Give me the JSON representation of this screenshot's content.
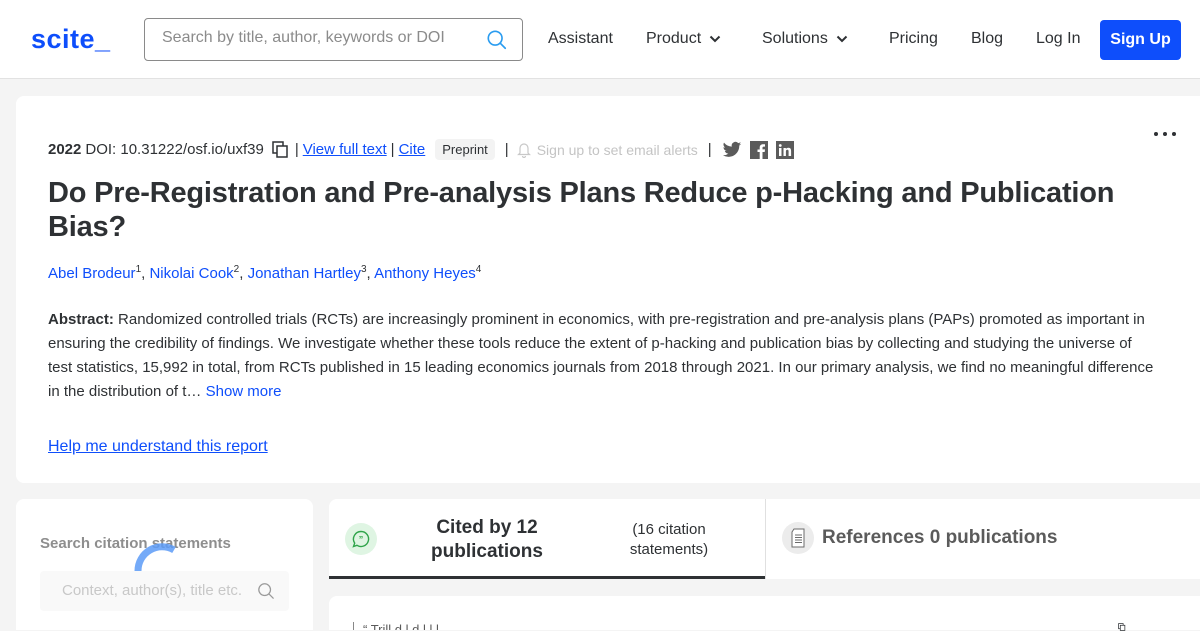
{
  "header": {
    "logo": "scite_",
    "search_placeholder": "Search by title, author, keywords or DOI",
    "nav": {
      "assistant": "Assistant",
      "product": "Product",
      "solutions": "Solutions",
      "pricing": "Pricing",
      "blog": "Blog",
      "login": "Log In",
      "signup": "Sign Up"
    }
  },
  "paper": {
    "year": "2022",
    "doi": "DOI: 10.31222/osf.io/uxf39",
    "view_full_text": "View full text",
    "cite": "Cite",
    "type_badge": "Preprint",
    "alert_text": "Sign up to set email alerts",
    "title": "Do Pre-Registration and Pre-analysis Plans Reduce p-Hacking and Publication Bias?",
    "authors": [
      {
        "name": "Abel Brodeur",
        "aff": "1"
      },
      {
        "name": "Nikolai Cook",
        "aff": "2"
      },
      {
        "name": "Jonathan Hartley",
        "aff": "3"
      },
      {
        "name": "Anthony Heyes",
        "aff": "4"
      }
    ],
    "abstract_label": "Abstract:",
    "abstract_text": "Randomized controlled trials (RCTs) are increasingly prominent in economics, with pre-registration and pre-analysis plans (PAPs) promoted as important in ensuring the credibility of findings. We investigate whether these tools reduce the extent of p-hacking and publication bias by collecting and studying the universe of test statistics, 15,992 in total, from RCTs published in 15 leading economics journals from 2018 through 2021. In our primary analysis, we find no meaningful difference in the distribution of t…",
    "show_more": "Show more",
    "help_link": "Help me understand this report"
  },
  "filter": {
    "title": "Search citation statements",
    "placeholder": "Context, author(s), title etc."
  },
  "tabs": {
    "cited_main": "Cited by 12 publications",
    "cited_sub": "(16 citation statements)",
    "references": "References 0 publications"
  },
  "citation_snippet": "“ Trill      d        l            d       l       l              l"
}
